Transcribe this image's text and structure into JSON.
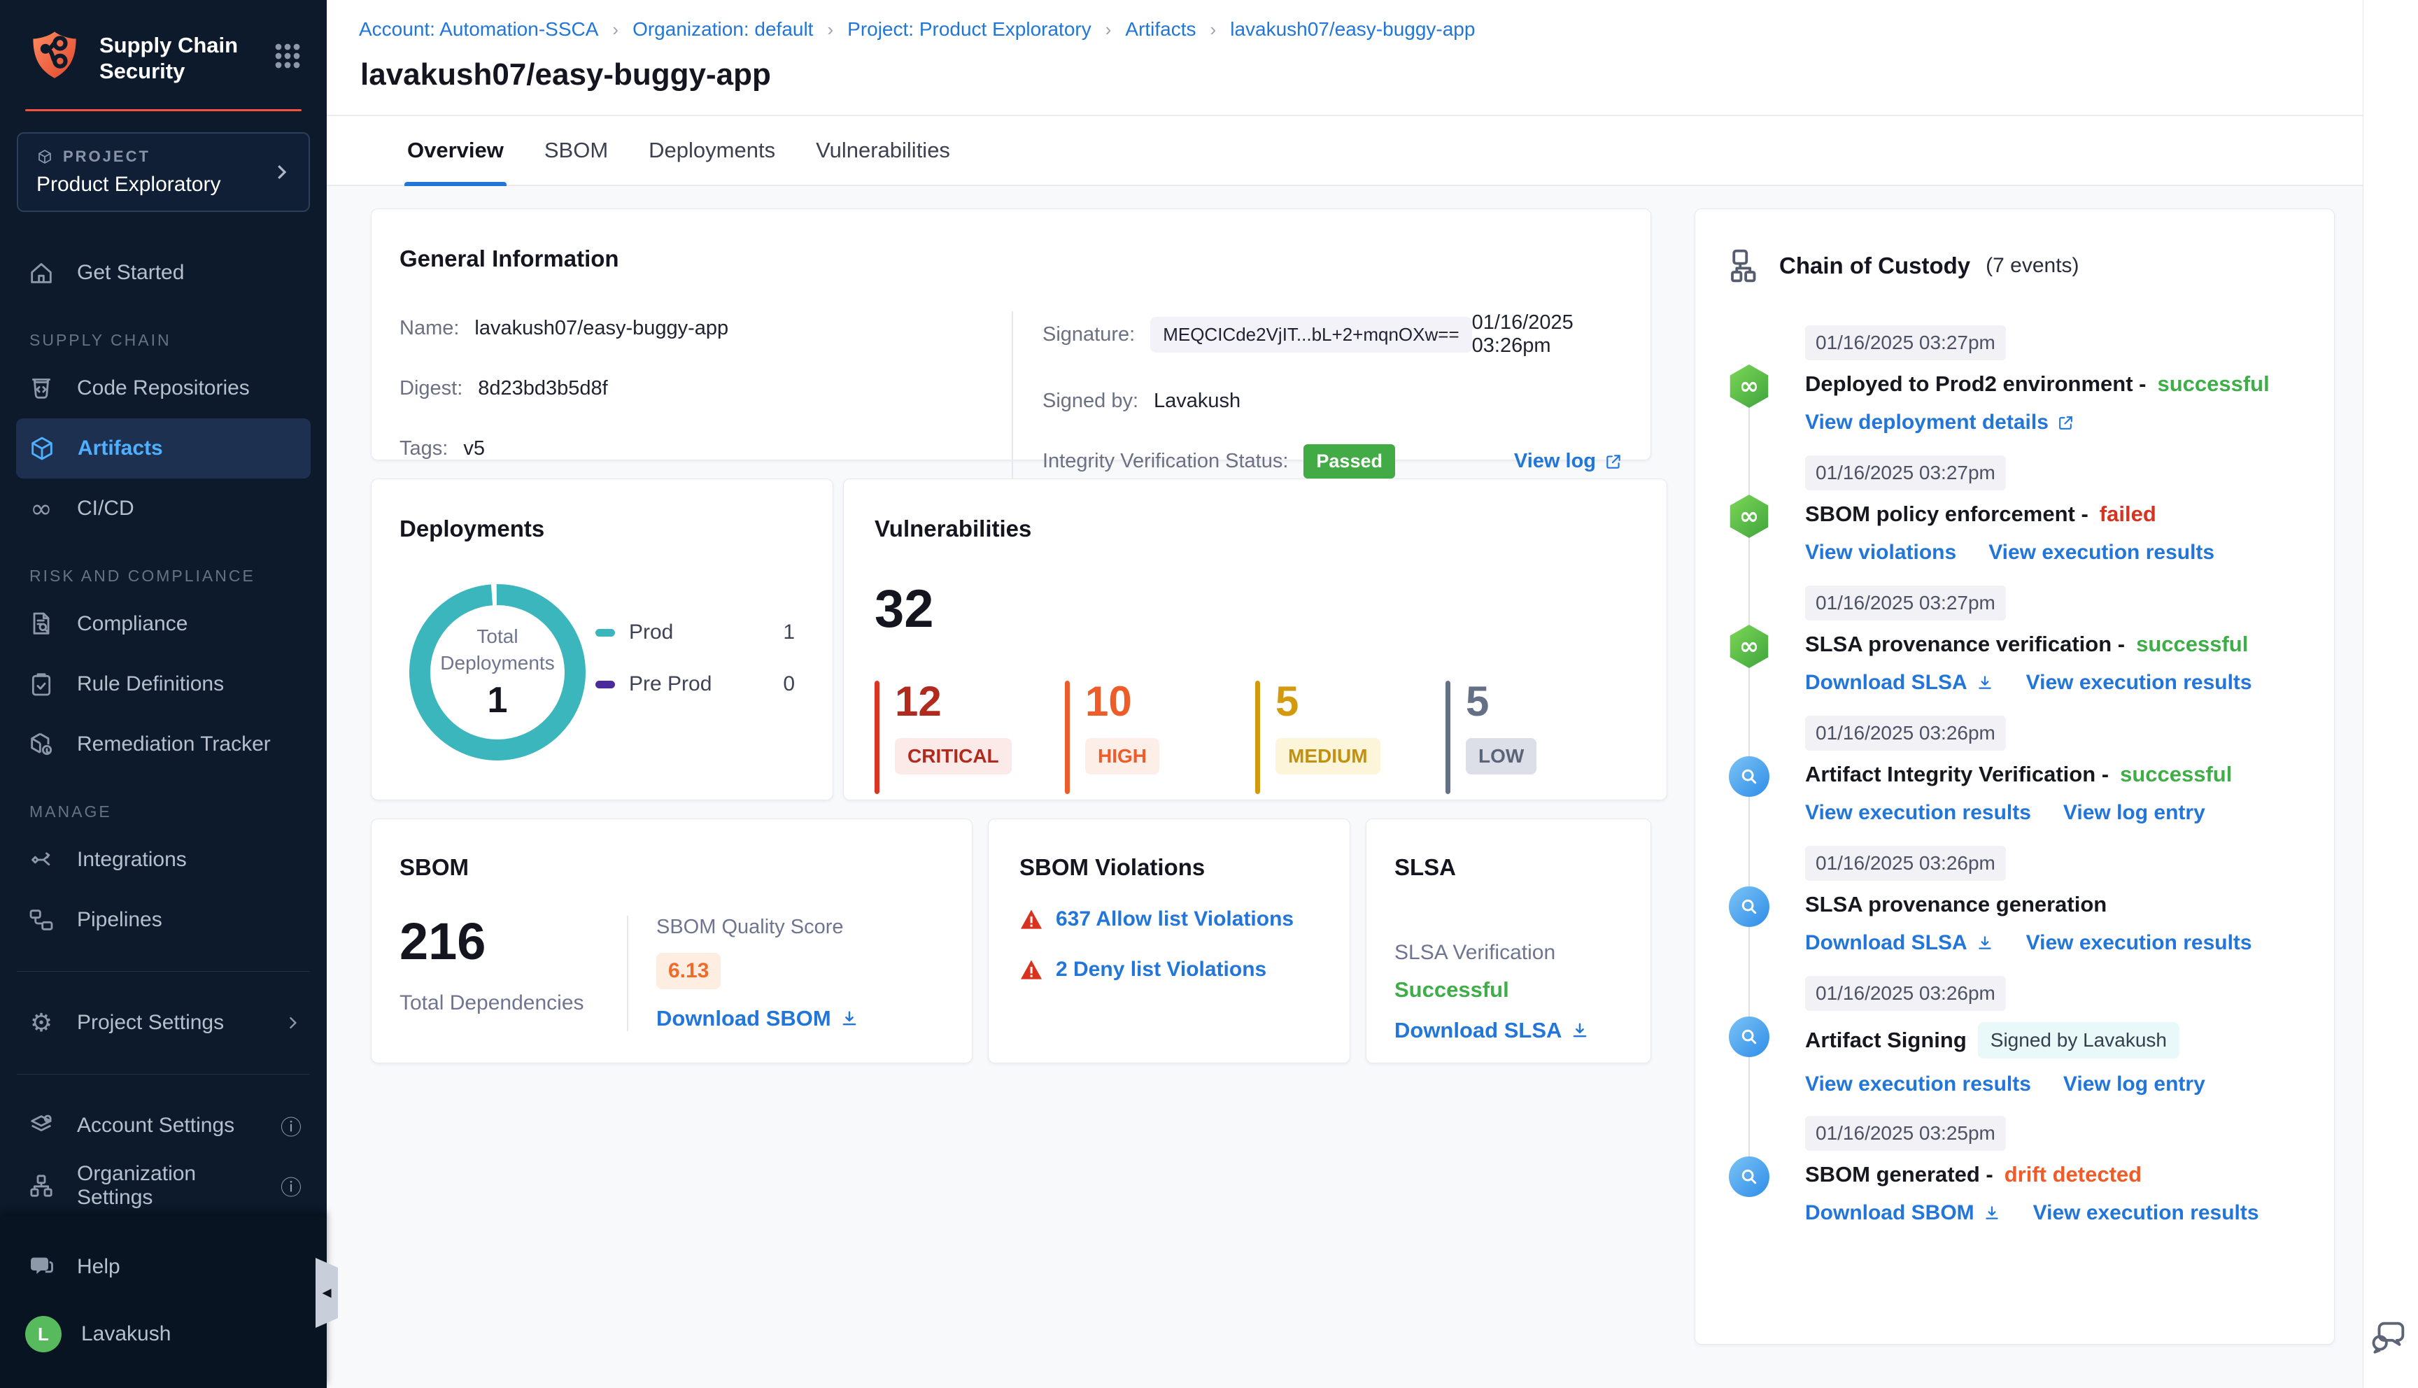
{
  "sidebar": {
    "app_title_line1": "Supply Chain",
    "app_title_line2": "Security",
    "project_label": "PROJECT",
    "project_name": "Product Exploratory",
    "get_started": "Get Started",
    "sections": {
      "supply_chain": "SUPPLY CHAIN",
      "risk": "RISK AND COMPLIANCE",
      "manage": "MANAGE"
    },
    "items": {
      "code_repositories": "Code Repositories",
      "artifacts": "Artifacts",
      "cicd": "CI/CD",
      "compliance": "Compliance",
      "rule_definitions": "Rule Definitions",
      "remediation_tracker": "Remediation Tracker",
      "integrations": "Integrations",
      "pipelines": "Pipelines",
      "project_settings": "Project Settings",
      "account_settings": "Account Settings",
      "organization_settings": "Organization Settings",
      "help": "Help"
    },
    "user": {
      "name": "Lavakush",
      "initial": "L"
    }
  },
  "header": {
    "breadcrumb": [
      "Account: Automation-SSCA",
      "Organization: default",
      "Project: Product Exploratory",
      "Artifacts",
      "lavakush07/easy-buggy-app"
    ],
    "title": "lavakush07/easy-buggy-app",
    "tabs": [
      "Overview",
      "SBOM",
      "Deployments",
      "Vulnerabilities"
    ]
  },
  "general_info": {
    "title": "General Information",
    "name_label": "Name:",
    "name_value": "lavakush07/easy-buggy-app",
    "digest_label": "Digest:",
    "digest_value": "8d23bd3b5d8f",
    "tags_label": "Tags:",
    "tags_value": "v5",
    "signature_label": "Signature:",
    "signature_value": "MEQCICde2VjIT...bL+2+mqnOXw==",
    "signature_date": "01/16/2025 03:26pm",
    "signed_by_label": "Signed by:",
    "signed_by_value": "Lavakush",
    "integrity_label": "Integrity Verification Status:",
    "integrity_status": "Passed",
    "view_log": "View log"
  },
  "deployments_card": {
    "title": "Deployments",
    "center_label": "Total Deployments",
    "center_value": "1",
    "legend": [
      {
        "name": "Prod",
        "value": "1",
        "color": "#3cb6bd"
      },
      {
        "name": "Pre Prod",
        "value": "0",
        "color": "#4b2a9b"
      }
    ]
  },
  "vulnerabilities_card": {
    "title": "Vulnerabilities",
    "total": "32",
    "severities": [
      {
        "count": "12",
        "label": "CRITICAL",
        "color": "#b02a1e"
      },
      {
        "count": "10",
        "label": "HIGH",
        "color": "#ee5c2a"
      },
      {
        "count": "5",
        "label": "MEDIUM",
        "color": "#d29a0c"
      },
      {
        "count": "5",
        "label": "LOW",
        "color": "#657086"
      }
    ]
  },
  "sbom_card": {
    "title": "SBOM",
    "total": "216",
    "total_label": "Total Dependencies",
    "quality_label": "SBOM Quality Score",
    "quality_score": "6.13",
    "download_label": "Download SBOM"
  },
  "sbom_violations_card": {
    "title": "SBOM Violations",
    "allow_link": "637 Allow list Violations",
    "deny_link": "2 Deny list Violations"
  },
  "slsa_card": {
    "title": "SLSA",
    "verification_label": "SLSA Verification",
    "status": "Successful",
    "download_label": "Download SLSA"
  },
  "chain_of_custody": {
    "title": "Chain of Custody",
    "events_count": "(7 events)",
    "events": [
      {
        "ts": "01/16/2025 03:27pm",
        "title": "Deployed to Prod2 environment -",
        "status": "successful",
        "links": [
          {
            "label": "View deployment details"
          }
        ]
      },
      {
        "ts": "01/16/2025 03:27pm",
        "title": "SBOM policy enforcement -",
        "status": "failed",
        "links": [
          {
            "label": "View violations"
          },
          {
            "label": "View execution results"
          }
        ]
      },
      {
        "ts": "01/16/2025 03:27pm",
        "title": "SLSA provenance verification -",
        "status": "successful",
        "links": [
          {
            "label": "Download SLSA"
          },
          {
            "label": "View execution results"
          }
        ]
      },
      {
        "ts": "01/16/2025 03:26pm",
        "title": "Artifact Integrity Verification -",
        "status": "successful",
        "links": [
          {
            "label": "View execution results"
          },
          {
            "label": "View log entry"
          }
        ]
      },
      {
        "ts": "01/16/2025 03:26pm",
        "title": "SLSA provenance generation",
        "status": "",
        "links": [
          {
            "label": "Download SLSA"
          },
          {
            "label": "View execution results"
          }
        ]
      },
      {
        "ts": "01/16/2025 03:26pm",
        "title": "Artifact Signing",
        "status": "",
        "badge": "Signed by Lavakush",
        "links": [
          {
            "label": "View execution results"
          },
          {
            "label": "View log entry"
          }
        ]
      },
      {
        "ts": "01/16/2025 03:25pm",
        "title": "SBOM generated -",
        "status": "drift detected",
        "links": [
          {
            "label": "Download SBOM"
          },
          {
            "label": "View execution results"
          }
        ]
      }
    ]
  },
  "chart_data": [
    {
      "type": "pie",
      "title": "Total Deployments",
      "categories": [
        "Prod",
        "Pre Prod"
      ],
      "values": [
        1,
        0
      ],
      "total": 1,
      "legend_position": "right"
    },
    {
      "type": "bar",
      "title": "Vulnerabilities",
      "categories": [
        "CRITICAL",
        "HIGH",
        "MEDIUM",
        "LOW"
      ],
      "values": [
        12,
        10,
        5,
        5
      ],
      "total": 32
    }
  ],
  "colors": {
    "sidebar_bg": "#0c1a2c",
    "accent_red": "#f5523c",
    "active_nav_blue": "#4fb0ff",
    "link_blue": "#2276d9",
    "success_green": "#3fae49",
    "failed_red": "#d7331f",
    "drift_orange": "#f25b28",
    "passed_badge_green": "#42ab45",
    "prod_teal": "#3cb6bd",
    "preprod_purple": "#4b2a9b",
    "critical": "#b02a1e",
    "high": "#ee5c2a",
    "medium": "#d29a0c",
    "low": "#657086",
    "quality_score_orange": "#f06a2b",
    "avatar_green": "#57ba5c"
  }
}
